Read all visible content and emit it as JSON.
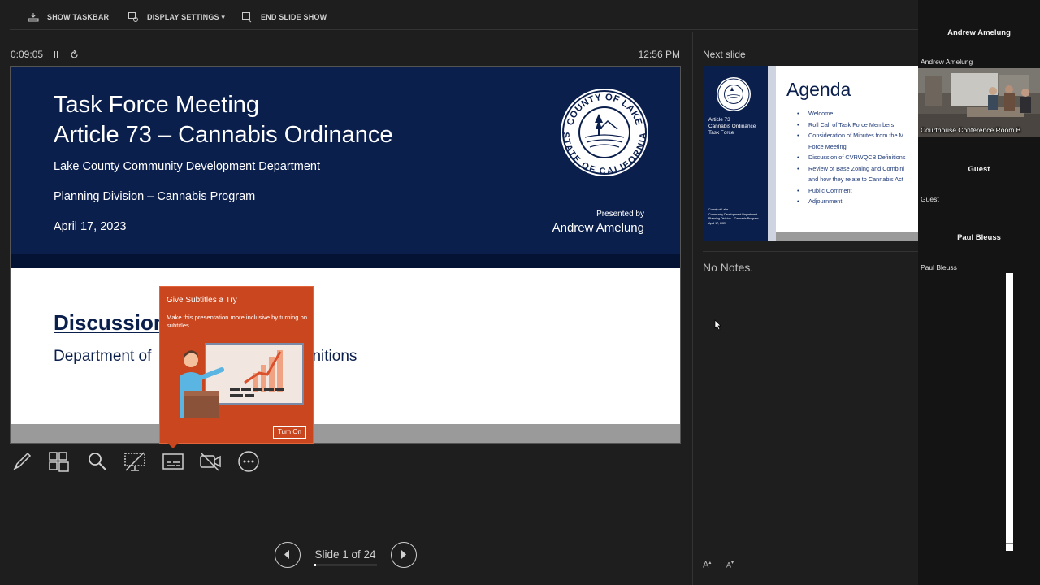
{
  "toolbar": {
    "show_taskbar": "SHOW TASKBAR",
    "display_settings": "DISPLAY SETTINGS ▾",
    "end_slide_show": "END SLIDE SHOW"
  },
  "presenter": {
    "elapsed": "0:09:05",
    "clock": "12:56 PM"
  },
  "current_slide": {
    "title": "Task Force Meeting\nArticle 73 – Cannabis Ordinance",
    "department": "Lake County Community Development Department",
    "division": "Planning Division – Cannabis Program",
    "date": "April 17, 2023",
    "presented_by": "Presented by",
    "presenter": "Andrew Amelung",
    "seal_top": "COUNTY OF LAKE",
    "seal_bottom": "STATE OF CALIFORNIA",
    "discussion": "Discussion",
    "subtitle_left": "Department of",
    "subtitle_right": "efinitions"
  },
  "tooltip": {
    "title": "Give Subtitles a Try",
    "body": "Make this presentation more inclusive by turning on subtitles.",
    "button": "Turn On"
  },
  "tools": [
    "pen-icon",
    "see-all-slides-icon",
    "zoom-icon",
    "black-screen-icon",
    "subtitles-icon",
    "camera-off-icon",
    "more-options-icon"
  ],
  "navigation": {
    "slide_count": "Slide 1 of 24",
    "progress_fraction": 0.0417
  },
  "next_slide": {
    "label": "Next slide",
    "side_title": "Article 73\nCannabis Ordinance\nTask Force",
    "side_footer": "County of Lake\nCommunity Development Department\nPlanning Division – Cannabis Program\nApril 17, 2023",
    "title": "Agenda",
    "items": [
      "Welcome",
      "Roll Call of Task Force Members",
      "Consideration of Minutes from the M\nForce Meeting",
      "Discussion of CVRWQCB Definitions",
      "Review of Base Zoning and Combini\nand how they relate to Cannabis Act",
      "Public Comment",
      "Adjournment"
    ]
  },
  "notes": {
    "text": "No Notes.",
    "increase_font": "A",
    "decrease_font": "A"
  },
  "participants": {
    "header_name": "Andrew Amelung",
    "video_name": "Andrew Amelung",
    "video_label": "Courthouse Conference Room B",
    "guest_center": "Guest",
    "guest_small": "Guest",
    "paul_center": "Paul Bleuss",
    "paul_small": "Paul Bleuss"
  },
  "colors": {
    "slide_navy": "#0b1f4d",
    "tooltip_orange": "#c9461f",
    "background": "#1e1e1e"
  }
}
